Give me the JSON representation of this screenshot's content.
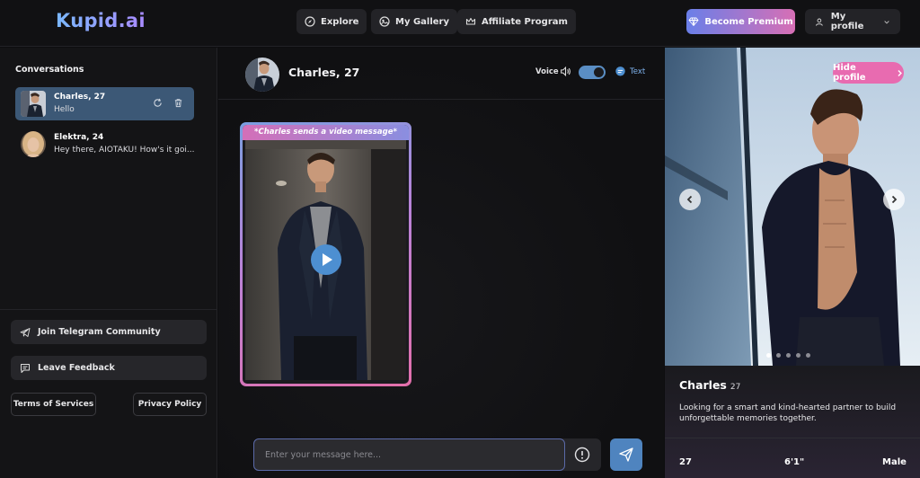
{
  "header": {
    "logo": "Kupid.ai",
    "nav": [
      {
        "label": "Explore",
        "icon": "compass-icon"
      },
      {
        "label": "My Gallery",
        "icon": "gallery-icon"
      },
      {
        "label": "Affiliate Program",
        "icon": "crown-icon"
      }
    ],
    "premium_label": "Become Premium",
    "profile_label": "My profile"
  },
  "sidebar": {
    "title": "Conversations",
    "conversations": [
      {
        "name": "Charles, 27",
        "message": "Hello",
        "active": true
      },
      {
        "name": "Elektra, 24",
        "message": "Hey there, AIOTAKU! How's it goi...",
        "active": false
      }
    ],
    "telegram_label": "Join Telegram Community",
    "feedback_label": "Leave Feedback",
    "terms_label": "Terms of Services",
    "privacy_label": "Privacy Policy"
  },
  "chat": {
    "name": "Charles, 27",
    "voice_label": "Voice",
    "text_label": "Text",
    "voice_toggle_on": true,
    "video_caption": "*Charles sends a video message*",
    "input_placeholder": "Enter your message here..."
  },
  "profile": {
    "hide_label": "Hide profile",
    "name": "Charles",
    "age": "27",
    "bio": "Looking for a smart and kind-hearted partner to build unforgettable memories together.",
    "stats": {
      "age": "27",
      "height": "6'1\"",
      "gender": "Male"
    },
    "carousel_total": 5,
    "carousel_active": 1
  },
  "colors": {
    "accent_blue": "#4f84bf",
    "accent_pink": "#e86bb0",
    "active_conversation": "#3c5876"
  }
}
